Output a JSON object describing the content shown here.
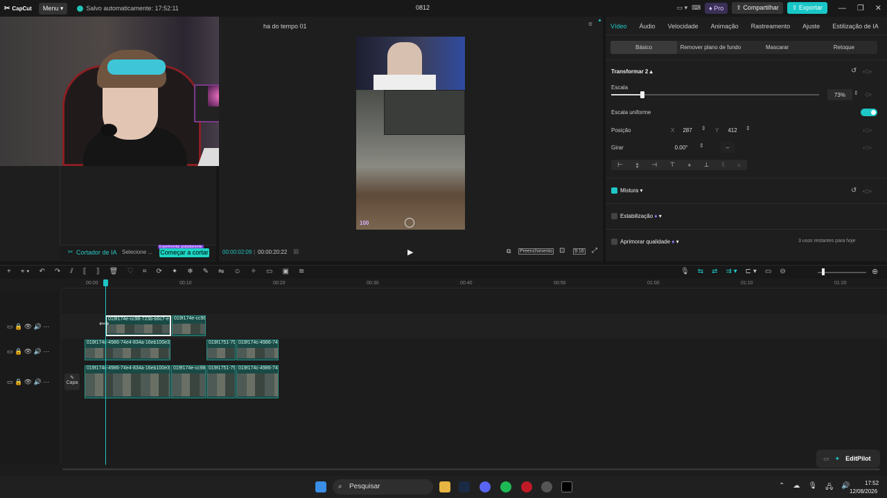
{
  "app": {
    "logo": "CapCut",
    "menu": "Menu",
    "autosave": "Salvo automaticamente: 17:52:11",
    "project_name": "0812",
    "pro": "Pro",
    "share": "Compartilhar",
    "export": "Exportar"
  },
  "player": {
    "title": "ha do tempo 01",
    "time_current": "00:00:02:09",
    "time_total": "00:00:20:22",
    "fill_label": "Preenchimento",
    "ratio": "9:16",
    "hud_number": "100"
  },
  "media": {
    "ai_cutter": "Cortador de IA",
    "select": "Selecione ...",
    "start_cut": "Começar a cortar",
    "free_badge": "Experimentar gratuitamente"
  },
  "inspector": {
    "tabs": [
      "Vídeo",
      "Áudio",
      "Velocidade",
      "Animação",
      "Rastreamento",
      "Ajuste",
      "Estilização de IA"
    ],
    "subtabs": [
      "Básico",
      "Remover plano de fundo",
      "Mascarar",
      "Retoque"
    ],
    "transform": "Transformar 2",
    "scale_label": "Escala",
    "scale_value": "73%",
    "scale_fraction": 0.73,
    "uniform_label": "Escala uniforme",
    "position_label": "Posição",
    "x_label": "X",
    "x_value": "287",
    "y_label": "Y",
    "y_value": "412",
    "rotate_label": "Girar",
    "rotate_value": "0.00°",
    "rotate_dash": "–",
    "blend_label": "Mistura",
    "stab_label": "Estabilização",
    "quality_label": "Aprimorar qualidade",
    "quality_note": "3 usos restantes para hoje"
  },
  "timeline": {
    "ruler": [
      "00:00",
      "00:10",
      "00:20",
      "00:30",
      "00:40",
      "00:50",
      "01:00",
      "01:10",
      "01:20"
    ],
    "cover": "Capa",
    "clips_top": [
      "019f174e-cc98-723b-b6c7-e",
      "019f174e-cc98"
    ],
    "clips_mid": [
      "019f174c-4986-74e4-834a-16eb100e33",
      "019f1751-79",
      "019f174c-4986-74"
    ],
    "clips_bot": [
      "019f174c-4986-74e4-834a-16eb100e33",
      "019f174e-cc98",
      "019f1751-79",
      "019f174c-4986-74"
    ],
    "editpilot": "EditPilot"
  },
  "taskbar": {
    "search": "Pesquisar",
    "time": "17:52",
    "date": "12/08/2026"
  }
}
